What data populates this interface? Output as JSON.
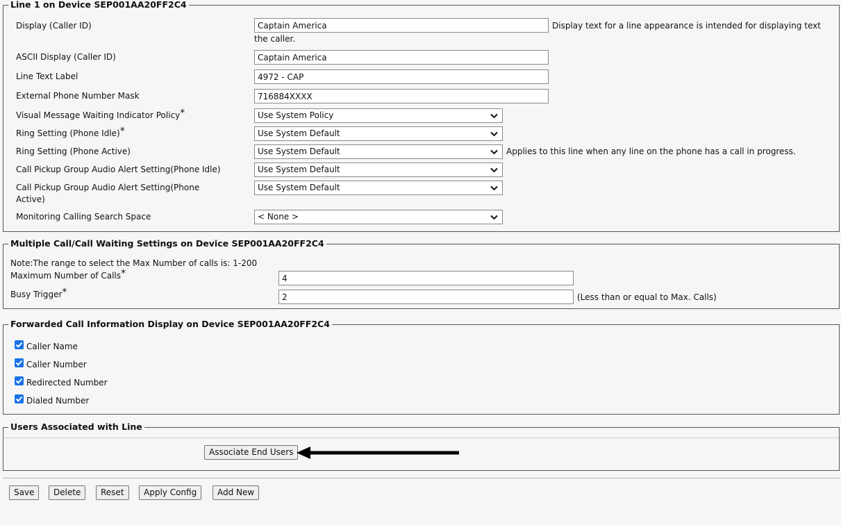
{
  "line_settings": {
    "legend": "Line 1 on Device SEP001AA20FF2C4",
    "display_label": "Display (Caller ID)",
    "display_value": "Captain America",
    "display_help_1": "Display text for a line appearance is intended for displaying text",
    "display_help_2": "the caller.",
    "ascii_label": "ASCII Display (Caller ID)",
    "ascii_value": "Captain America",
    "text_label_label": "Line Text Label",
    "text_label_value": "4972 - CAP",
    "mask_label": "External Phone Number Mask",
    "mask_value": "716884XXXX",
    "vmwi_label": "Visual Message Waiting Indicator Policy",
    "vmwi_value": "Use System Policy",
    "ring_idle_label": "Ring Setting (Phone Idle)",
    "ring_idle_value": "Use System Default",
    "ring_active_label": "Ring Setting (Phone Active)",
    "ring_active_value": "Use System Default",
    "ring_active_help": "Applies to this line when any line on the phone has a call in progress.",
    "pickup_idle_label": "Call Pickup Group Audio Alert Setting(Phone Idle)",
    "pickup_idle_value": "Use System Default",
    "pickup_active_label_1": "Call Pickup Group Audio Alert Setting(Phone",
    "pickup_active_label_2": "Active)",
    "pickup_active_value": "Use System Default",
    "monitoring_label": "Monitoring Calling Search Space",
    "monitoring_value": "< None >"
  },
  "call_waiting": {
    "legend": "Multiple Call/Call Waiting Settings on Device SEP001AA20FF2C4",
    "note": "Note:The range to select the Max Number of calls is: 1-200",
    "max_calls_label": "Maximum Number of Calls",
    "max_calls_value": "4",
    "busy_trigger_label": "Busy Trigger",
    "busy_trigger_value": "2",
    "busy_trigger_help": "(Less than or equal to Max. Calls)"
  },
  "forwarded": {
    "legend": "Forwarded Call Information Display on Device SEP001AA20FF2C4",
    "items": [
      {
        "label": "Caller Name",
        "checked": true
      },
      {
        "label": "Caller Number",
        "checked": true
      },
      {
        "label": "Redirected Number",
        "checked": true
      },
      {
        "label": "Dialed Number",
        "checked": true
      }
    ]
  },
  "users": {
    "legend": "Users Associated with Line",
    "associate_button": "Associate End Users"
  },
  "toolbar": {
    "save": "Save",
    "delete": "Delete",
    "reset": "Reset",
    "apply_config": "Apply Config",
    "add_new": "Add New"
  },
  "required_marker": "*",
  "colors": {
    "checkbox": "#1a73e8",
    "border": "#555555",
    "background": "#f6f6f6"
  }
}
